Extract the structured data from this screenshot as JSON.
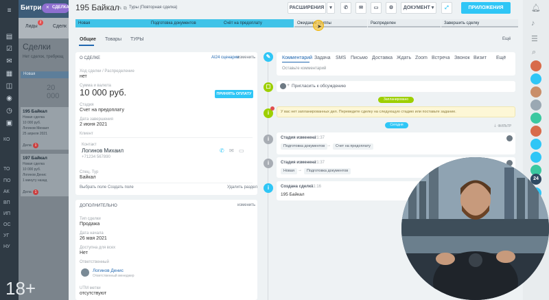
{
  "left": {
    "app_title": "Битри",
    "nav": [
      "Лиды",
      "Сделк"
    ],
    "lead_badge": "2",
    "heading": "Сделки",
    "note": "Нет сделок, требующ",
    "stage_col": "Новая",
    "amount": "20 000",
    "cards": [
      {
        "title": "195 Байкал",
        "sub1": "Новая сделка",
        "sub2": "10 000 руб.",
        "contact": "Логинов Михаил",
        "date": "25 апреля 2021",
        "action": "Дела",
        "badge": "1"
      },
      {
        "title": "197 Байкал",
        "sub1": "Новая сделка",
        "sub2": "10 000 руб.",
        "contact": "Логинов Денис",
        "date": "1 минуту назад",
        "action": "Дела",
        "badge": "1"
      }
    ],
    "age_watermark": "18+",
    "sidebar_labels": [
      "КО",
      "ТО",
      "ПО",
      "АК",
      "ВП",
      "ИП",
      "ОС",
      "УГ",
      "НУ"
    ]
  },
  "deal_badge": "СДЕЛКА",
  "header": {
    "title": "195 Байкал",
    "category": "Туры (Повторная сделка)",
    "ext_button": "РАСШИРЕНИЯ",
    "doc_button": "ДОКУМЕНТ",
    "apps_button": "ПРИЛОЖЕНИЯ"
  },
  "stages": [
    "Новая",
    "Подготовка документов",
    "Счёт на предоплату",
    "Ожидание группы",
    "Распределен",
    "Завершить сделку"
  ],
  "tabs": {
    "items": [
      "Общие",
      "Товары",
      "ТУРЫ"
    ],
    "more": "Ещё"
  },
  "about": {
    "title": "О СДЕЛКЕ",
    "ai": "AI24 сценарии",
    "edit": "изменить",
    "f1_label": "Ход сделки / Распределение",
    "f1_value": "нет",
    "sum_label": "Сумма и валюта",
    "sum_value": "10 000 руб.",
    "pay_button": "ПРИНЯТЬ ОПЛАТУ",
    "stage_label": "Стадия",
    "stage_value": "Счет на предоплату",
    "close_label": "Дата завершения",
    "close_value": "2 июня 2021",
    "client_label": "Клиент",
    "contact_label": "Контакт",
    "contact_name": "Логинов Михаил",
    "contact_phone": "+71234 567890",
    "sep_label": "Спец. Тур",
    "sep_value": "Байкал",
    "choose_field": "Выбрать поле",
    "create_field": "Создать поле",
    "delete_section": "Удалить раздел"
  },
  "extra": {
    "title": "ДОПОЛНИТЕЛЬНО",
    "edit": "изменить",
    "type_label": "Тип сделки",
    "type_value": "Продажа",
    "start_label": "Дата начала",
    "start_value": "26 мая 2021",
    "avail_label": "Доступна для всех",
    "avail_value": "Нет",
    "resp_label": "Ответственный",
    "resp_name": "Логинов Денис",
    "resp_role": "Ответственный менеджер",
    "utm_label": "UTM метки",
    "utm_value": "отсутствуют"
  },
  "activity": {
    "tabs": [
      "Комментарий",
      "Задача",
      "SMS",
      "Письмо",
      "Доставка",
      "Ждать",
      "Zoom",
      "Встреча",
      "Звонок",
      "Визит"
    ],
    "more": "Ещё",
    "placeholder": "Оставьте комментарий",
    "invite": "Пригласить к обсуждению",
    "planned_pill": "Запланировано",
    "warning": "У вас нет запланированных дел. Переведите сделку на следующую стадию или поставьте задание.",
    "history_pill": "Сегодня",
    "filter": "ФИЛЬТР",
    "events": [
      {
        "title": "Стадия изменена",
        "time": "21:37",
        "from": "Подготовка документов",
        "to": "Счет на предоплату"
      },
      {
        "title": "Стадия изменена",
        "time": "21:37",
        "from": "Новая",
        "to": "Подготовка документов"
      }
    ],
    "created_title": "Создана сделка",
    "created_time": "21:16",
    "created_value": "195 Байкал"
  },
  "right": {
    "badge_24": "24"
  }
}
